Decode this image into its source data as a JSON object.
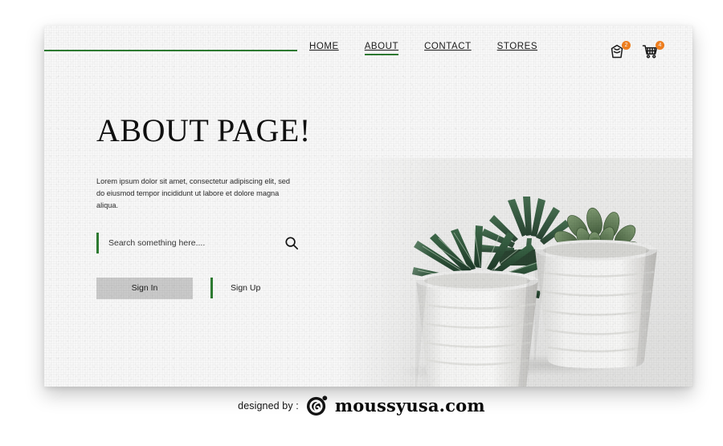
{
  "accent": {
    "green": "#2e7d32",
    "badge_orange": "#f58220",
    "button_gray": "#cdcdcd"
  },
  "nav": {
    "items": [
      {
        "label": "HOME",
        "active": false
      },
      {
        "label": "ABOUT",
        "active": true
      },
      {
        "label": "CONTACT",
        "active": false
      },
      {
        "label": "STORES",
        "active": false
      }
    ]
  },
  "header_icons": [
    {
      "name": "shopping-bag-icon",
      "badge": "2"
    },
    {
      "name": "shopping-cart-icon",
      "badge": "4"
    }
  ],
  "hero": {
    "headline": "ABOUT PAGE!",
    "paragraph": "Lorem ipsum dolor sit amet, consectetur adipiscing elit, sed do eiusmod tempor incididunt ut labore et dolore magna aliqua.",
    "image_alt": "two succulent plants in white ribbed ceramic pots"
  },
  "search": {
    "placeholder": "Search something here....",
    "value": "",
    "icon": "search-icon"
  },
  "actions": {
    "sign_in": "Sign In",
    "sign_up": "Sign Up"
  },
  "credit": {
    "prefix": "designed by :",
    "brand": "moussyusa.com",
    "logo": "moussyusa-logo-icon"
  }
}
